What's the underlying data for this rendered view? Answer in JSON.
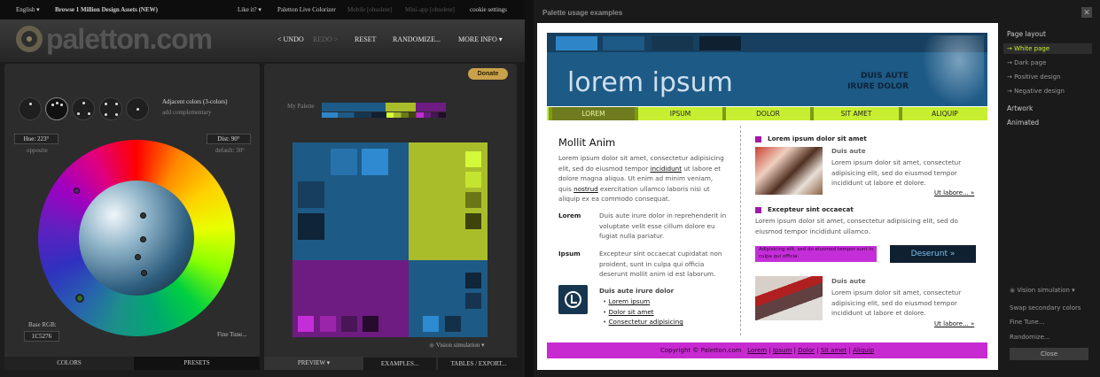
{
  "topbar": {
    "lang": "English ▾",
    "browse": "Browse 1 Million Design Assets (NEW)",
    "likeit": "Like it? ▾",
    "live": "Paletton Live Colorizer",
    "mobile": "Mobile [obsolete]",
    "mini": "Mini-app [obsolete]",
    "cookie": "cookie settings"
  },
  "header": {
    "logo": "paletton.com",
    "undo": "< UNDO",
    "redo": "REDO >",
    "reset": "RESET",
    "randomize": "RANDOMIZE...",
    "more": "MORE INFO ▾"
  },
  "donate": "Donate",
  "scheme": {
    "title": "Adjacent colors (3-colors)",
    "add": "add complementary"
  },
  "hue": {
    "label": "Hue: 223°",
    "sub": "opposite"
  },
  "dist": {
    "label": "Dist: 90°",
    "sub": "default: 30°"
  },
  "mypalette": "My Palette",
  "base": {
    "label": "Base RGB:",
    "value": "1C5276"
  },
  "finetune": "Fine Tune...",
  "tabs": {
    "colors": "COLORS",
    "presets": "PRESETS",
    "preview": "PREVIEW ▾",
    "examples": "EXAMPLES...",
    "tables": "TABLES / EXPORT..."
  },
  "vision": "Vision simulation ▾",
  "colors": {
    "blue": "#1d5a86",
    "lime": "#a9bd2a",
    "purple": "#6e1c82",
    "accent": "#c7ee30",
    "magenta": "#c72ad0"
  },
  "dialog": {
    "title": "Palette usage examples",
    "close_x": "✕",
    "banner_title": "lorem ipsum",
    "banner_right": [
      "DUIS AUTE",
      "IRURE DOLOR"
    ],
    "nav": [
      "LOREM",
      "IPSUM",
      "DOLOR",
      "SIT AMET",
      "ALIQUIP"
    ],
    "left": {
      "heading": "Mollit Anim",
      "para1": "Lorem ipsum dolor sit amet, consectetur adipisicing elit, sed do eiusmod tempor",
      "link1": "incididunt",
      "para1b": "ut labore et dolore magna aliqua. Ut enim ad minim veniam, quis",
      "link2": "nostrud",
      "para1c": "exercitation ullamco laboris nisi ut aliquip ex ea commodo consequat.",
      "term1": "Lorem",
      "def1": "Duis aute irure dolor in reprehenderit in voluptate velit esse cillum dolore eu fugiat nulla pariatur.",
      "term2": "Ipsum",
      "def2": "Excepteur sint occaecat cupidatat non proident, sunt in culpa qui officia deserunt mollit anim id est laborum.",
      "listhead": "Duis aute irure dolor",
      "list": [
        "Lorem ipsum",
        "Dolor sit amet",
        "Consectetur adipisicing"
      ]
    },
    "right": {
      "h1": "Lorem ipsum dolor sit amet",
      "sub1": "Duis aute",
      "p1": "Lorem ipsum dolor sit amet, consectetur adipisicing elit, sed do eiusmod tempor incididunt ut labore et dolore.",
      "more": "Ut labore... »",
      "h2": "Excepteur sint occaecat",
      "p2": "Lorem ipsum dolor sit amet, consectetur adipisicing elit, sed do eiusmod tempor incididunt ullamco.",
      "callout": "Adipisicing elit, sed do eiusmod tempor sunt in culpa qui officia.",
      "button": "Deserunt »",
      "sub2": "Duis aute",
      "p3": "Lorem ipsum dolor sit amet, consectetur adipisicing elit, sed do eiusmod tempor incididunt ut labore et dolore.",
      "more2": "Ut labore... »"
    },
    "footer": {
      "copy": "Copyright © Paletton.com",
      "links": [
        "Lorem",
        "Ipsum",
        "Dolor",
        "Sit amet",
        "Aliquip"
      ]
    },
    "side": {
      "pagelayout": "Page layout",
      "items": [
        "→ White page",
        "→ Dark page",
        "→ Positive design",
        "→ Negative design"
      ],
      "artwork": "Artwork",
      "animated": "Animated",
      "vision": "Vision simulation ▾",
      "swap": "Swap secondary colors",
      "fine": "Fine Tune...",
      "random": "Randomize...",
      "close": "Close"
    }
  }
}
